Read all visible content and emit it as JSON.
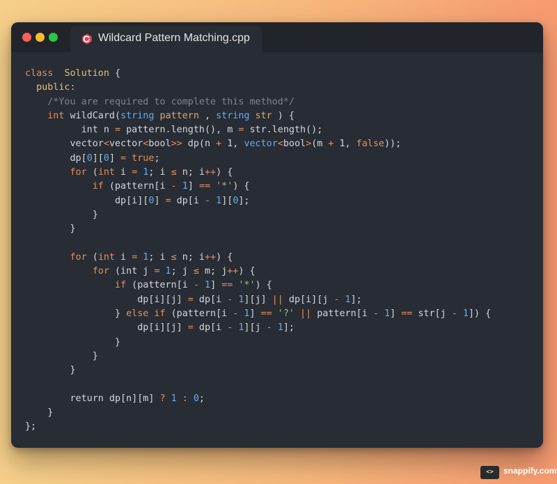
{
  "window": {
    "tab_title": "Wildcard Pattern Matching.cpp",
    "tab_icon": "cpp-file-icon",
    "traffic_lights": [
      "close",
      "minimize",
      "maximize"
    ]
  },
  "code_lines": [
    [
      [
        "k",
        "class"
      ],
      [
        "",
        "  "
      ],
      [
        "f",
        "Solution"
      ],
      [
        "",
        " {"
      ]
    ],
    [
      [
        "",
        ""
      ],
      [
        "f",
        "  public:"
      ]
    ],
    [
      [
        "c",
        "    /*You are required to complete this method*/"
      ]
    ],
    [
      [
        "",
        ""
      ],
      [
        "k",
        "    int"
      ],
      [
        "",
        " wildCard("
      ],
      [
        "t",
        "string"
      ],
      [
        " ",
        ""
      ],
      [
        "v",
        " pattern"
      ],
      [
        "",
        " ,"
      ],
      [
        "t",
        " string"
      ],
      [
        "v",
        " str"
      ],
      [
        "",
        " ) {"
      ]
    ],
    [
      [
        "",
        ""
      ],
      [
        "",
        "          int n "
      ],
      [
        "o",
        "="
      ],
      [
        "",
        " pattern."
      ],
      [
        "",
        "length(), "
      ],
      [
        "",
        "m "
      ],
      [
        "o",
        "="
      ],
      [
        "",
        " str."
      ],
      [
        "",
        "length();"
      ]
    ],
    [
      [
        "",
        "        vector"
      ],
      [
        "o",
        "<"
      ],
      [
        "",
        "vector"
      ],
      [
        "o",
        "<"
      ],
      [
        "",
        "bool"
      ],
      [
        "o",
        ">>"
      ],
      [
        "",
        " dp("
      ],
      [
        "",
        "n "
      ],
      [
        "o",
        "+"
      ],
      [
        "",
        " 1, "
      ],
      [
        "t",
        "vector"
      ],
      [
        "o",
        "<"
      ],
      [
        "",
        "bool"
      ],
      [
        "o",
        ">"
      ],
      [
        "",
        "("
      ],
      [
        "",
        "m "
      ],
      [
        "o",
        "+"
      ],
      [
        "",
        " 1, "
      ],
      [
        "k",
        "false"
      ],
      [
        "",
        "));"
      ]
    ],
    [
      [
        "",
        "        dp["
      ],
      [
        "n",
        "0"
      ],
      [
        "",
        "]["
      ],
      [
        "n",
        "0"
      ],
      [
        "",
        "] "
      ],
      [
        "o",
        "="
      ],
      [
        "k",
        " true"
      ],
      [
        "",
        ";"
      ]
    ],
    [
      [
        "k",
        "        for"
      ],
      [
        "",
        " ("
      ],
      [
        "k",
        "int"
      ],
      [
        "",
        " i "
      ],
      [
        "o",
        "="
      ],
      [
        "n",
        " 1"
      ],
      [
        "",
        ";"
      ],
      [
        "",
        " i "
      ],
      [
        "o",
        "≤"
      ],
      [
        "",
        " n; i"
      ],
      [
        "o",
        "++"
      ],
      [
        "",
        ") {"
      ]
    ],
    [
      [
        "k",
        "            if"
      ],
      [
        "",
        " (pattern[i "
      ],
      [
        "o",
        "-"
      ],
      [
        "n",
        " 1"
      ],
      [
        "",
        "] "
      ],
      [
        "o",
        "=="
      ],
      [
        "s",
        " '*'"
      ],
      [
        "",
        ") {"
      ]
    ],
    [
      [
        "",
        "                dp[i]["
      ],
      [
        "n",
        "0"
      ],
      [
        "",
        "] "
      ],
      [
        "o",
        "="
      ],
      [
        "",
        " dp[i "
      ],
      [
        "o",
        "-"
      ],
      [
        "n",
        " 1"
      ],
      [
        "",
        "]["
      ],
      [
        "n",
        "0"
      ],
      [
        "",
        "];"
      ]
    ],
    [
      [
        "",
        "            }"
      ]
    ],
    [
      [
        "",
        "        }"
      ]
    ],
    [
      [
        "",
        ""
      ]
    ],
    [
      [
        "k",
        "        for"
      ],
      [
        "",
        " ("
      ],
      [
        "k",
        "int"
      ],
      [
        "",
        " i "
      ],
      [
        "o",
        "="
      ],
      [
        "n",
        " 1"
      ],
      [
        "",
        ";"
      ],
      [
        "",
        " i "
      ],
      [
        "o",
        "≤"
      ],
      [
        "",
        " n; i"
      ],
      [
        "o",
        "++"
      ],
      [
        "",
        ") {"
      ]
    ],
    [
      [
        "k",
        "            for"
      ],
      [
        "",
        " (int j "
      ],
      [
        "o",
        "="
      ],
      [
        "n",
        " 1"
      ],
      [
        "",
        ";"
      ],
      [
        "",
        " j "
      ],
      [
        "o",
        "≤"
      ],
      [
        "",
        " m; j"
      ],
      [
        "o",
        "++"
      ],
      [
        "",
        ") {"
      ]
    ],
    [
      [
        "k",
        "                if"
      ],
      [
        "",
        " (pattern[i "
      ],
      [
        "o",
        "-"
      ],
      [
        "n",
        " 1"
      ],
      [
        "",
        "] "
      ],
      [
        "o",
        "=="
      ],
      [
        "s",
        " '*'"
      ],
      [
        "",
        ") {"
      ]
    ],
    [
      [
        "",
        "                    dp[i][j] "
      ],
      [
        "o",
        "="
      ],
      [
        "",
        " dp[i "
      ],
      [
        "o",
        "-"
      ],
      [
        "n",
        " 1"
      ],
      [
        "",
        "][j] "
      ],
      [
        "o",
        "||"
      ],
      [
        "",
        " dp[i][j "
      ],
      [
        "o",
        "-"
      ],
      [
        "n",
        " 1"
      ],
      [
        "",
        "];"
      ]
    ],
    [
      [
        "",
        "                } "
      ],
      [
        "k",
        "else if"
      ],
      [
        "",
        " (pattern[i "
      ],
      [
        "o",
        "-"
      ],
      [
        "n",
        " 1"
      ],
      [
        "",
        "] "
      ],
      [
        "o",
        "=="
      ],
      [
        "s",
        " '?'"
      ],
      [
        "o",
        " ||"
      ],
      [
        "",
        " pattern[i "
      ],
      [
        "o",
        "-"
      ],
      [
        "n",
        " 1"
      ],
      [
        "",
        "] "
      ],
      [
        "o",
        "=="
      ],
      [
        "",
        " str[j "
      ],
      [
        "o",
        "-"
      ],
      [
        "n",
        " 1"
      ],
      [
        "",
        "]) {"
      ]
    ],
    [
      [
        "",
        "                    dp[i][j] "
      ],
      [
        "o",
        "="
      ],
      [
        "",
        " dp[i "
      ],
      [
        "o",
        "-"
      ],
      [
        "n",
        " 1"
      ],
      [
        "",
        "][j "
      ],
      [
        "o",
        "-"
      ],
      [
        "n",
        " 1"
      ],
      [
        "",
        "];"
      ]
    ],
    [
      [
        "",
        "                }"
      ]
    ],
    [
      [
        "",
        "            }"
      ]
    ],
    [
      [
        "",
        "        }"
      ]
    ],
    [
      [
        "",
        ""
      ]
    ],
    [
      [
        "",
        "        return dp[n][m] "
      ],
      [
        "o",
        "?"
      ],
      [
        "n",
        " 1"
      ],
      [
        "o",
        " :"
      ],
      [
        "n",
        " 0"
      ],
      [
        "",
        ";"
      ]
    ],
    [
      [
        "",
        "    }"
      ]
    ],
    [
      [
        "",
        "};"
      ]
    ]
  ],
  "watermark": {
    "text": "snappify.com",
    "icon": "code-brackets-icon",
    "glyph": "<>"
  }
}
